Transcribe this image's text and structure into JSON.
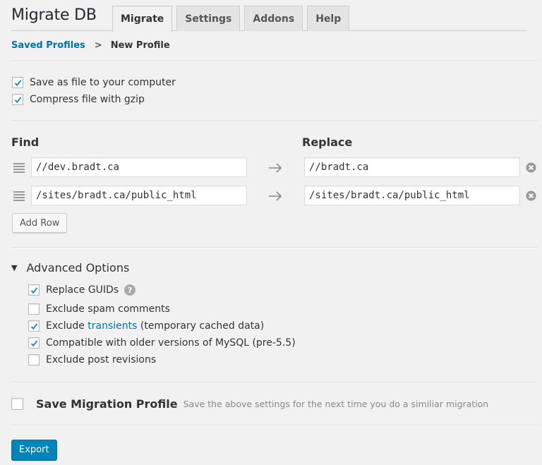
{
  "header": {
    "title": "Migrate DB",
    "tabs": [
      {
        "label": "Migrate",
        "active": true
      },
      {
        "label": "Settings",
        "active": false
      },
      {
        "label": "Addons",
        "active": false
      },
      {
        "label": "Help",
        "active": false
      }
    ]
  },
  "breadcrumb": {
    "parent": "Saved Profiles",
    "separator": ">",
    "current": "New Profile"
  },
  "export_options": [
    {
      "label": "Save as file to your computer",
      "checked": true
    },
    {
      "label": "Compress file with gzip",
      "checked": true
    }
  ],
  "find_replace": {
    "find_label": "Find",
    "replace_label": "Replace",
    "rows": [
      {
        "find": "//dev.bradt.ca",
        "replace": "//bradt.ca"
      },
      {
        "find": "/sites/bradt.ca/public_html",
        "replace": "/sites/bradt.ca/public_html"
      }
    ],
    "add_row_label": "Add Row"
  },
  "advanced": {
    "title": "Advanced Options",
    "expanded": true,
    "options": [
      {
        "label": "Replace GUIDs",
        "checked": true,
        "help": "?"
      },
      {
        "label": "Exclude spam comments",
        "checked": false
      },
      {
        "prefix": "Exclude ",
        "link": "transients",
        "suffix": " (temporary cached data)",
        "checked": true
      },
      {
        "label": "Compatible with older versions of MySQL (pre-5.5)",
        "checked": true
      },
      {
        "label": "Exclude post revisions",
        "checked": false
      }
    ]
  },
  "save_profile": {
    "label": "Save Migration Profile",
    "hint": "Save the above settings for the next time you do a similiar migration",
    "checked": false
  },
  "export_button": "Export",
  "colors": {
    "accent": "#0073aa",
    "primary_button": "#0085ba",
    "background": "#f1f1f1"
  }
}
